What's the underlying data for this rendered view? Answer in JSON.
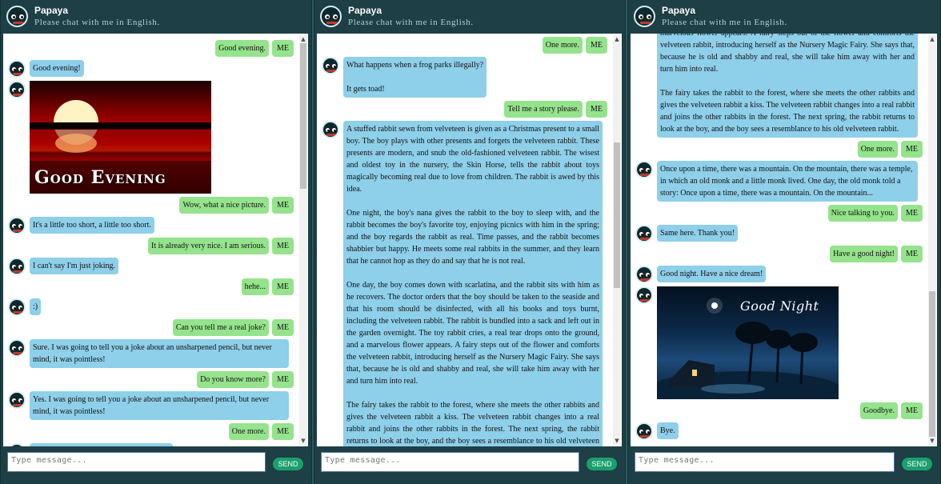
{
  "bot": {
    "name": "Papaya",
    "status": "Please chat with me in English."
  },
  "me_label": "ME",
  "input_placeholder": "Type message...",
  "send_label": "SEND",
  "colors": {
    "user_bubble": "#95e38c",
    "bot_bubble": "#8ecfe9",
    "send_button": "#1aa06b",
    "panel_bg": "#1d3f45"
  },
  "panels": [
    {
      "scroll_top": "0",
      "scrollbar_position": 0.0,
      "messages": [
        {
          "from": "me",
          "text": "Good evening."
        },
        {
          "from": "bot",
          "text": "Good evening!"
        },
        {
          "from": "bot",
          "image": "good-evening-sunset",
          "caption": "Good Evening"
        },
        {
          "from": "me",
          "text": "Wow, what a nice picture."
        },
        {
          "from": "bot",
          "text": "It's a little too short, a little too short."
        },
        {
          "from": "me",
          "text": "It is already very nice. I am serious."
        },
        {
          "from": "bot",
          "text": "I can't say I'm just joking."
        },
        {
          "from": "me",
          "text": "hehe..."
        },
        {
          "from": "bot",
          "text": ":)"
        },
        {
          "from": "me",
          "text": "Can you tell me a real joke?"
        },
        {
          "from": "bot",
          "text": "Sure. I was going to tell you a joke about an unsharpened pencil, but never mind, it was pointless!"
        },
        {
          "from": "me",
          "text": "Do you know more?"
        },
        {
          "from": "bot",
          "text": "Yes. I was going to tell you a joke about an unsharpened pencil, but never mind, it was pointless!"
        },
        {
          "from": "me",
          "text": "One more."
        },
        {
          "from": "bot",
          "text": "What happens when a frog parks illegally?"
        }
      ]
    },
    {
      "scroll_top": "-4",
      "scrollbar_position": 0.4,
      "messages": [
        {
          "from": "me",
          "text": "One more."
        },
        {
          "from": "bot",
          "text": "What happens when a frog parks illegally?\n\nIt gets toad!"
        },
        {
          "from": "me",
          "text": "Tell me a story please."
        },
        {
          "from": "bot",
          "long": true,
          "text": "A stuffed rabbit sewn from velveteen is given as a Christmas present to a small boy. The boy plays with other presents and forgets the velveteen rabbit. These presents are modern, and snub the old-fashioned velveteen rabbit. The wisest and oldest toy in the nursery, the Skin Horse, tells the rabbit about toys magically becoming real due to love from children. The rabbit is awed by this idea.\n\nOne night, the boy's nana gives the rabbit to the boy to sleep with, and the rabbit becomes the boy's favorite toy, enjoying picnics with him in the spring; and the boy regards the rabbit as real. Time passes, and the rabbit becomes shabbier but happy. He meets some real rabbits in the summer, and they learn that he cannot hop as they do and say that he is not real.\n\nOne day, the boy comes down with scarlatina, and the rabbit sits with him as he recovers. The doctor orders that the boy should be taken to the seaside and that his room should be disinfected, with all his books and toys burnt, including the velveteen rabbit. The rabbit is bundled into a sack and left out in the garden overnight. The toy rabbit cries, a real tear drops onto the ground, and a marvelous flower appears. A fairy steps out of the flower and comforts the velveteen rabbit, introducing herself as the Nursery Magic Fairy. She says that, because he is old and shabby and real, she will take him away with her and turn him into real.\n\nThe fairy takes the rabbit to the forest, where she meets the other rabbits and gives the velveteen rabbit a kiss. The velveteen rabbit changes into a real rabbit and joins the other rabbits in the forest. The next spring, the rabbit returns to look at the boy, and the boy sees a resemblance to his old velveteen rabbit."
        }
      ]
    },
    {
      "scroll_top": "0",
      "scrollbar_position": 1.0,
      "messages": [
        {
          "from": "bot",
          "long": true,
          "text": "overnight. The toy rabbit cries, a real tear drops onto the ground, and a marvelous flower appears. A fairy steps out of the flower and comforts the velveteen rabbit, introducing herself as the Nursery Magic Fairy. She says that, because he is old and shabby and real, she will take him away with her and turn him into real.\n\nThe fairy takes the rabbit to the forest, where she meets the other rabbits and gives the velveteen rabbit a kiss. The velveteen rabbit changes into a real rabbit and joins the other rabbits in the forest. The next spring, the rabbit returns to look at the boy, and the boy sees a resemblance to his old velveteen rabbit."
        },
        {
          "from": "me",
          "text": "One more."
        },
        {
          "from": "bot",
          "text": "Once upon a time, there was a mountain. On the mountain, there was a temple, in which an old monk and a little monk lived. One day, the old monk told a story: Once upon a time, there was a mountain. On the mountain..."
        },
        {
          "from": "me",
          "text": "Nice talking to you."
        },
        {
          "from": "bot",
          "text": "Same here. Thank you!"
        },
        {
          "from": "me",
          "text": "Have a good night!"
        },
        {
          "from": "bot",
          "text": "Good night. Have a nice dream!"
        },
        {
          "from": "bot",
          "image": "good-night-cottage",
          "caption": "Good Night"
        },
        {
          "from": "me",
          "text": "Goodbye."
        },
        {
          "from": "bot",
          "text": "Bye."
        }
      ]
    }
  ]
}
